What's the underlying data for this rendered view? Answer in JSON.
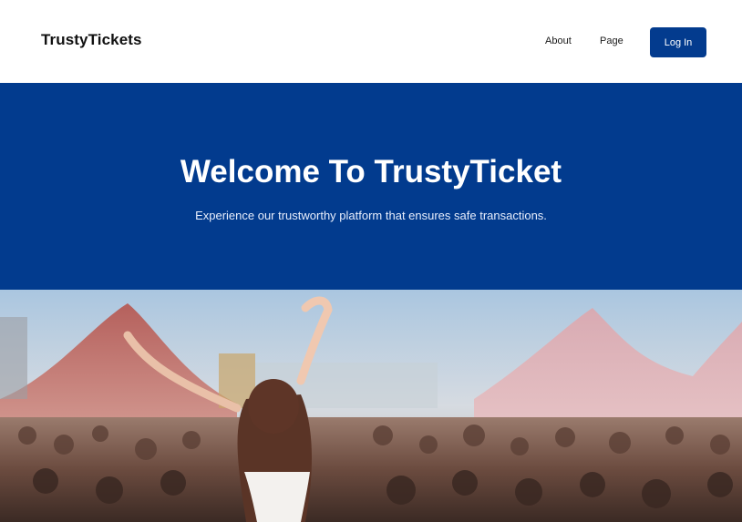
{
  "header": {
    "brand": "TrustyTickets",
    "nav": [
      {
        "label": "About"
      },
      {
        "label": "Page"
      }
    ],
    "login_label": "Log In"
  },
  "hero": {
    "title": "Welcome To TrustyTicket",
    "subtitle": "Experience our trustworthy platform that ensures safe transactions.",
    "background_color": "#023b8e"
  },
  "image": {
    "description_name": "concert-crowd-photo"
  },
  "colors": {
    "primary": "#033b8e",
    "text_dark": "#111111",
    "white": "#ffffff"
  }
}
